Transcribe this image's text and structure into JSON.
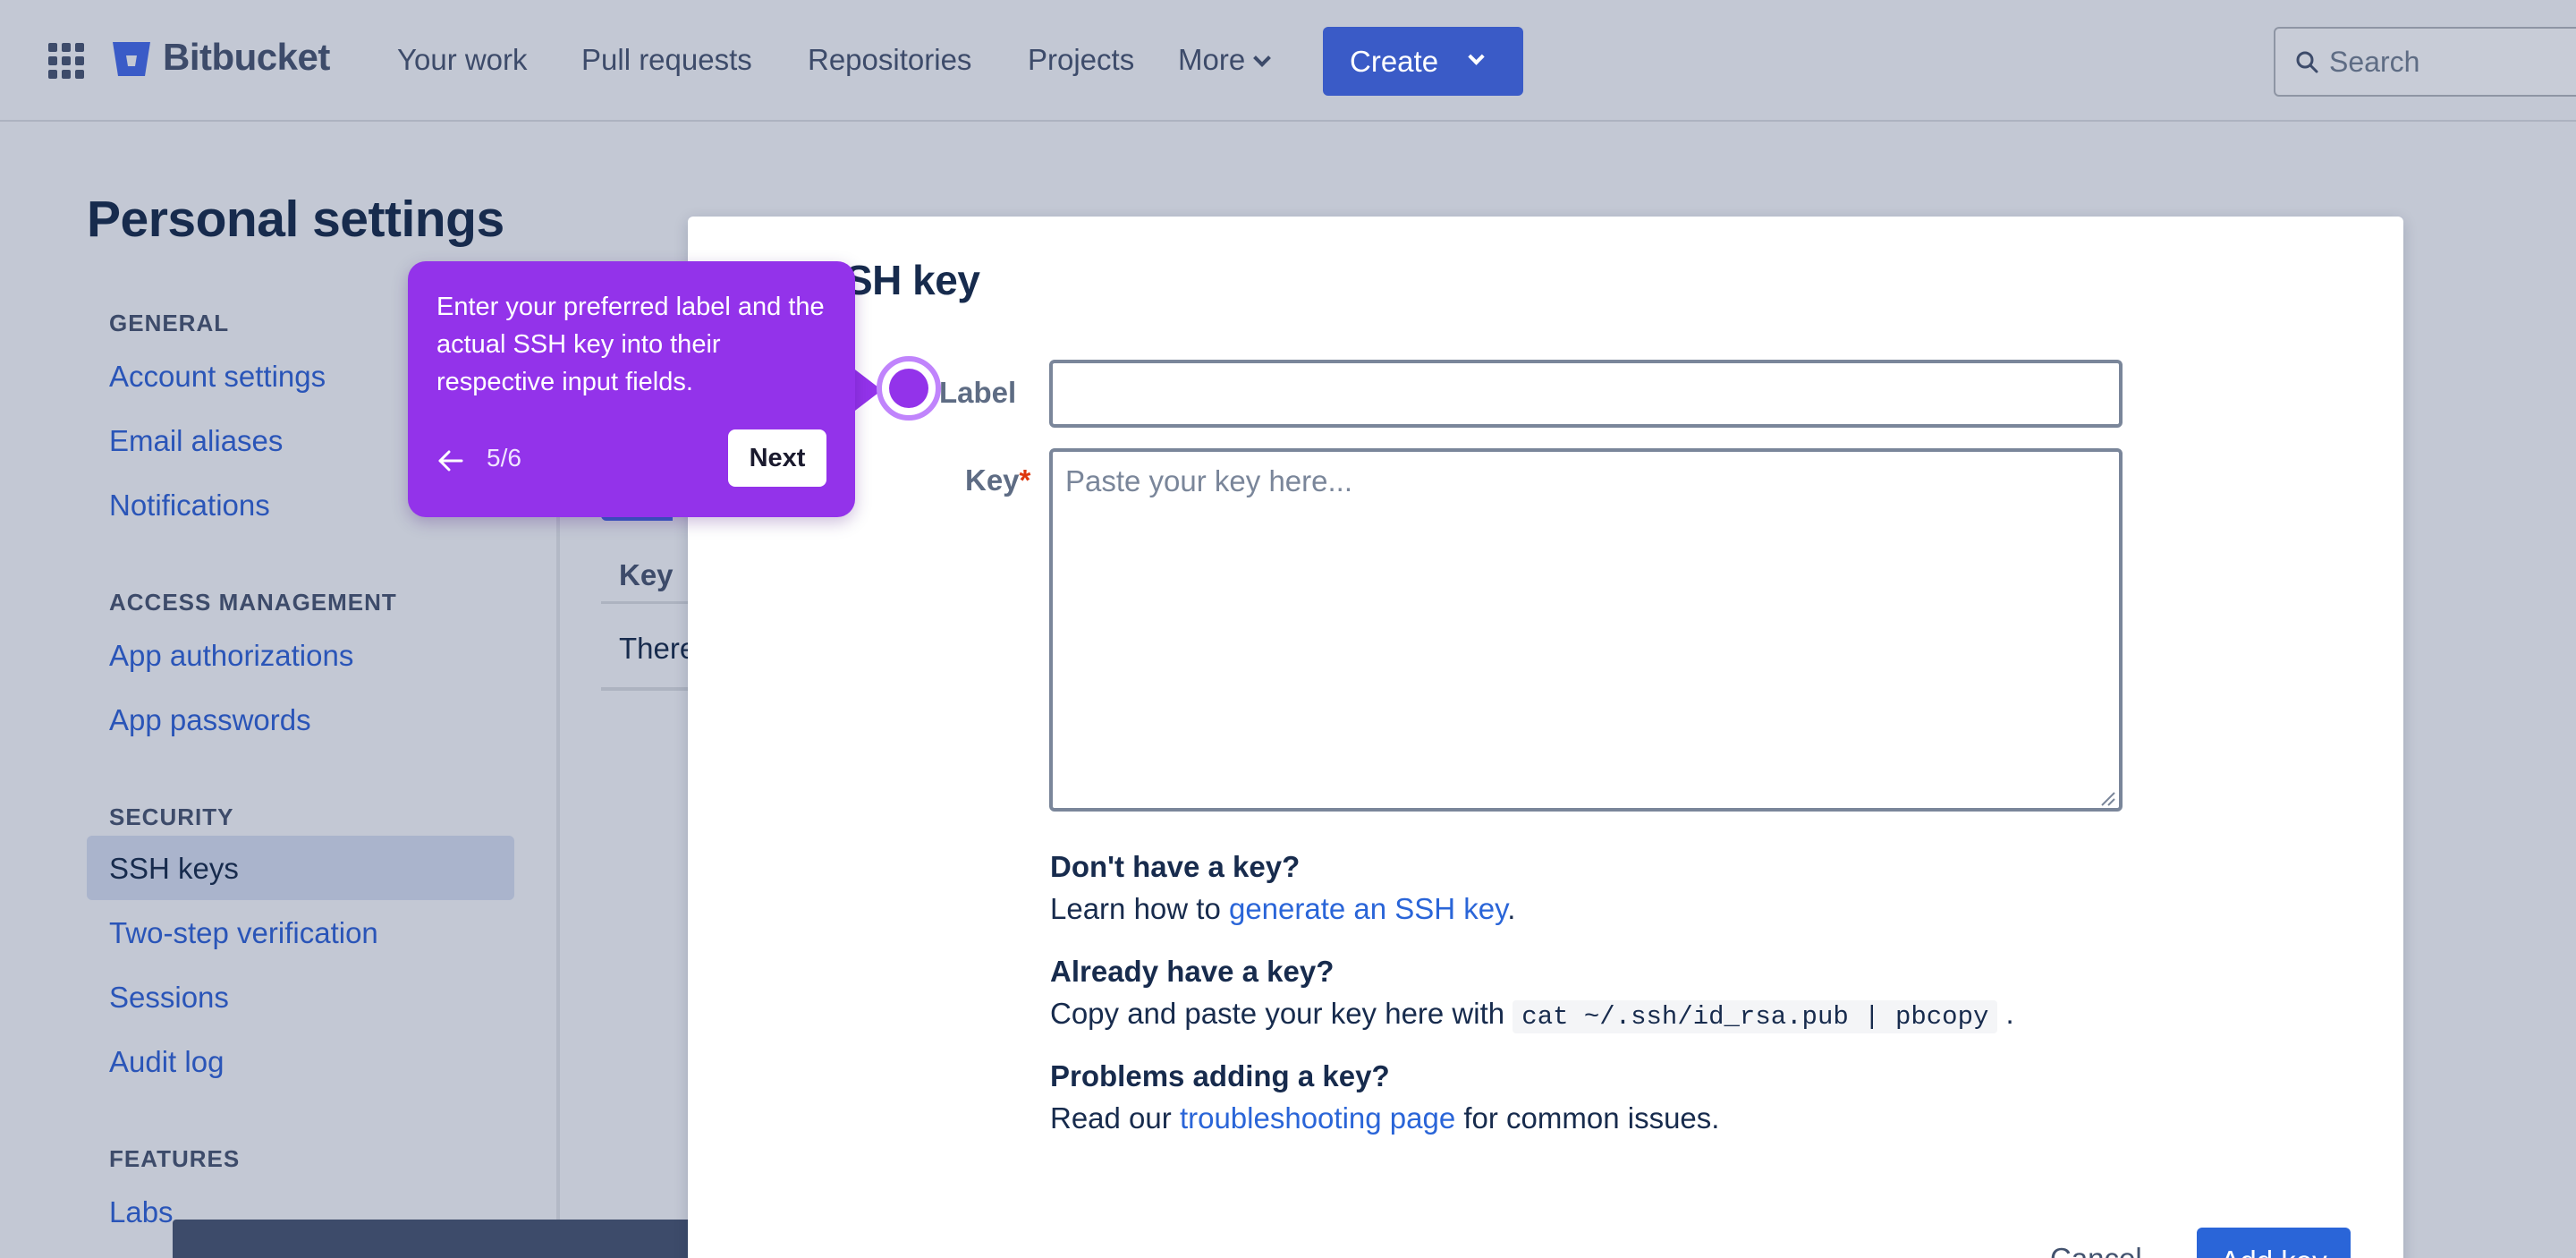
{
  "topnav": {
    "brand": "Bitbucket",
    "items": [
      {
        "label": "Your work"
      },
      {
        "label": "Pull requests"
      },
      {
        "label": "Repositories"
      },
      {
        "label": "Projects"
      },
      {
        "label": "More"
      }
    ],
    "create_label": "Create",
    "search_placeholder": "Search",
    "accent_color": "#3a5bc7"
  },
  "sidebar": {
    "title": "Personal settings",
    "sections": [
      {
        "heading": "GENERAL",
        "items": [
          "Account settings",
          "Email aliases",
          "Notifications"
        ]
      },
      {
        "heading": "ACCESS MANAGEMENT",
        "items": [
          "App authorizations",
          "App passwords"
        ]
      },
      {
        "heading": "SECURITY",
        "items": [
          "SSH keys",
          "Two-step verification",
          "Sessions",
          "Audit log"
        ]
      },
      {
        "heading": "FEATURES",
        "items": [
          "Labs"
        ]
      }
    ],
    "active_item": "SSH keys"
  },
  "background": {
    "column_header": "Key",
    "row_text": "There"
  },
  "modal": {
    "title": "SH key",
    "label_field": {
      "label": "Label",
      "value": ""
    },
    "key_field": {
      "label": "Key",
      "required_mark": "*",
      "placeholder": "Paste your key here...",
      "value": ""
    },
    "help": [
      {
        "heading": "Don't have a key?",
        "pre": "Learn how to ",
        "link": "generate an SSH key",
        "post": "."
      },
      {
        "heading": "Already have a key?",
        "pre": "Copy and paste your key here with ",
        "code": "cat ~/.ssh/id_rsa.pub | pbcopy",
        "post": " ."
      },
      {
        "heading": "Problems adding a key?",
        "pre": "Read our ",
        "link": "troubleshooting page",
        "post": " for common issues."
      }
    ],
    "cancel_label": "Cancel",
    "add_label": "Add key"
  },
  "tour": {
    "text": "Enter your preferred label and the actual SSH key into their respective input fields.",
    "step": "5/6",
    "next_label": "Next",
    "color": "#9333ea"
  }
}
